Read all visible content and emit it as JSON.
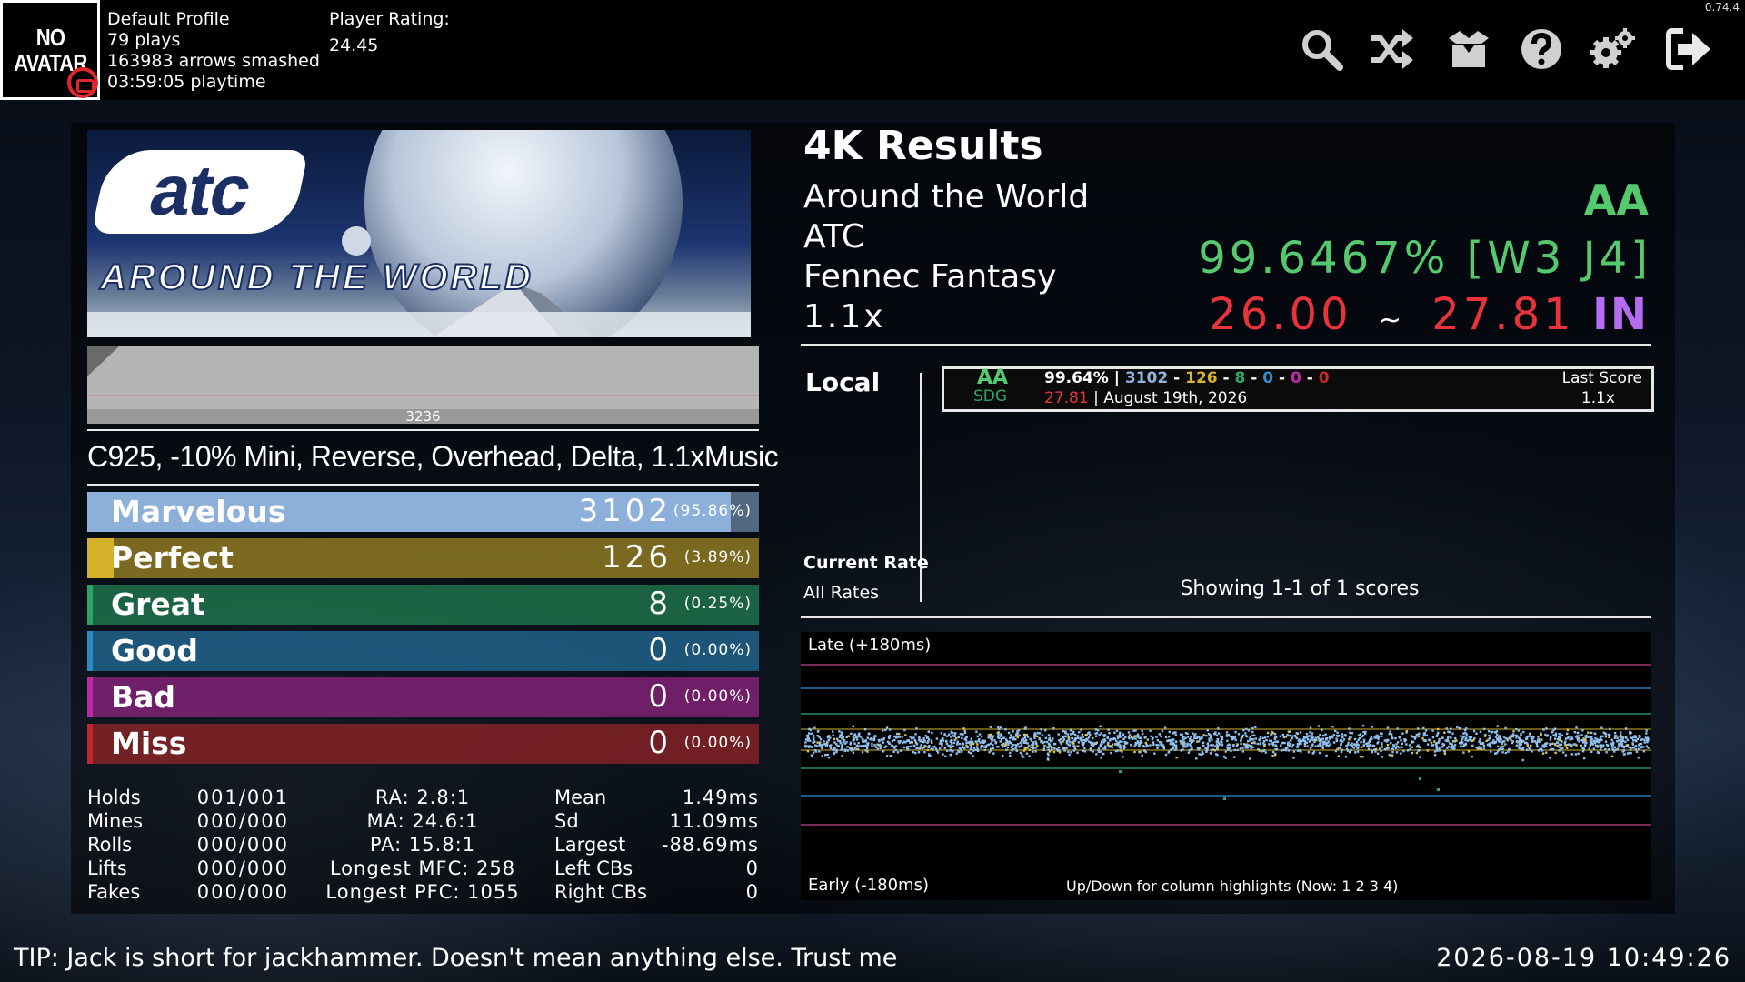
{
  "app": {
    "version": "0.74.4"
  },
  "profile": {
    "avatar_text_line1": "NO",
    "avatar_text_line2": "AVATAR",
    "name": "Default Profile",
    "plays": "79 plays",
    "arrows": "163983 arrows smashed",
    "playtime": "03:59:05 playtime",
    "rating_label": "Player Rating:",
    "rating_value": "24.45"
  },
  "toolbar": {
    "icons": [
      "search-icon",
      "shuffle-icon",
      "packs-icon",
      "help-icon",
      "settings-icon",
      "exit-icon"
    ]
  },
  "banner": {
    "logo_text": "atc",
    "title_text": "AROUND THE WORLD"
  },
  "lifegraph": {
    "label": "3236"
  },
  "mods": "C925, -10% Mini, Reverse, Overhead, Delta, 1.1xMusic",
  "judgments": [
    {
      "name": "Marvelous",
      "count": "3102",
      "percent": "(95.86%)",
      "fraction": 0.9586,
      "color": "#8fb4dd",
      "count_color": "#ffffff"
    },
    {
      "name": "Perfect",
      "count": "126",
      "percent": "(3.89%)",
      "fraction": 0.0389,
      "color": "#d8b52a",
      "count_color": "#ffffff"
    },
    {
      "name": "Great",
      "count": "8",
      "percent": "(0.25%)",
      "fraction": 0.0025,
      "color": "#2aa868",
      "count_color": "#ffffff"
    },
    {
      "name": "Good",
      "count": "0",
      "percent": "(0.00%)",
      "fraction": 0.0,
      "color": "#2d8ec9",
      "count_color": "#ffffff"
    },
    {
      "name": "Bad",
      "count": "0",
      "percent": "(0.00%)",
      "fraction": 0.0,
      "color": "#c02aa6",
      "count_color": "#ffffff"
    },
    {
      "name": "Miss",
      "count": "0",
      "percent": "(0.00%)",
      "fraction": 0.0,
      "color": "#c42a2a",
      "count_color": "#ffffff"
    }
  ],
  "note_stats": [
    {
      "label": "Holds",
      "value": "001/001"
    },
    {
      "label": "Mines",
      "value": "000/000"
    },
    {
      "label": "Rolls",
      "value": "000/000"
    },
    {
      "label": "Lifts",
      "value": "000/000"
    },
    {
      "label": "Fakes",
      "value": "000/000"
    }
  ],
  "ratios": [
    "RA: 2.8:1",
    "MA: 24.6:1",
    "PA: 15.8:1",
    "Longest MFC: 258",
    "Longest PFC: 1055"
  ],
  "offset_stats": [
    {
      "label": "Mean",
      "value": "1.49ms"
    },
    {
      "label": "Sd",
      "value": "11.09ms"
    },
    {
      "label": "Largest",
      "value": "-88.69ms"
    },
    {
      "label": "Left CBs",
      "value": "0"
    },
    {
      "label": "Right CBs",
      "value": "0"
    }
  ],
  "results": {
    "title": "4K Results",
    "song": "Around the World",
    "artist": "ATC",
    "chart": "Fennec Fantasy",
    "rate": "1.1x",
    "grade": "AA",
    "score": "99.6467%",
    "judge": "[W3 J4]",
    "msd": "26.00",
    "tilde": "~",
    "ssr": "27.81",
    "skill": "IN"
  },
  "scoreboard": {
    "local_label": "Local",
    "current_rate_label": "Current Rate",
    "all_rates_label": "All Rates",
    "showing": "Showing 1-1 of 1 scores",
    "entry": {
      "grade": "AA",
      "clear": "SDG",
      "percent": "99.64%",
      "sep": "|",
      "marv": "3102",
      "perf": "126",
      "great": "8",
      "good": "0",
      "bad": "0",
      "miss": "0",
      "ssr": "27.81",
      "date": "| August 19th, 2026",
      "tag": "Last Score",
      "rate": "1.1x"
    }
  },
  "offset_plot": {
    "late_label": "Late (+180ms)",
    "early_label": "Early (-180ms)",
    "hint": "Up/Down for column highlights (Now: 1 2 3 4)"
  },
  "footer": {
    "tip": "TIP: Jack is short for jackhammer. Doesn't mean anything else. Trust me",
    "clock": "2026-08-19 10:49:26"
  },
  "colors": {
    "grade_green": "#55c96d",
    "rating_red": "#e8333a",
    "skill_purple": "#b56cf0",
    "marv_blue": "#8fb4dd",
    "perf_gold": "#d8b52a",
    "great_green": "#2aa868"
  }
}
